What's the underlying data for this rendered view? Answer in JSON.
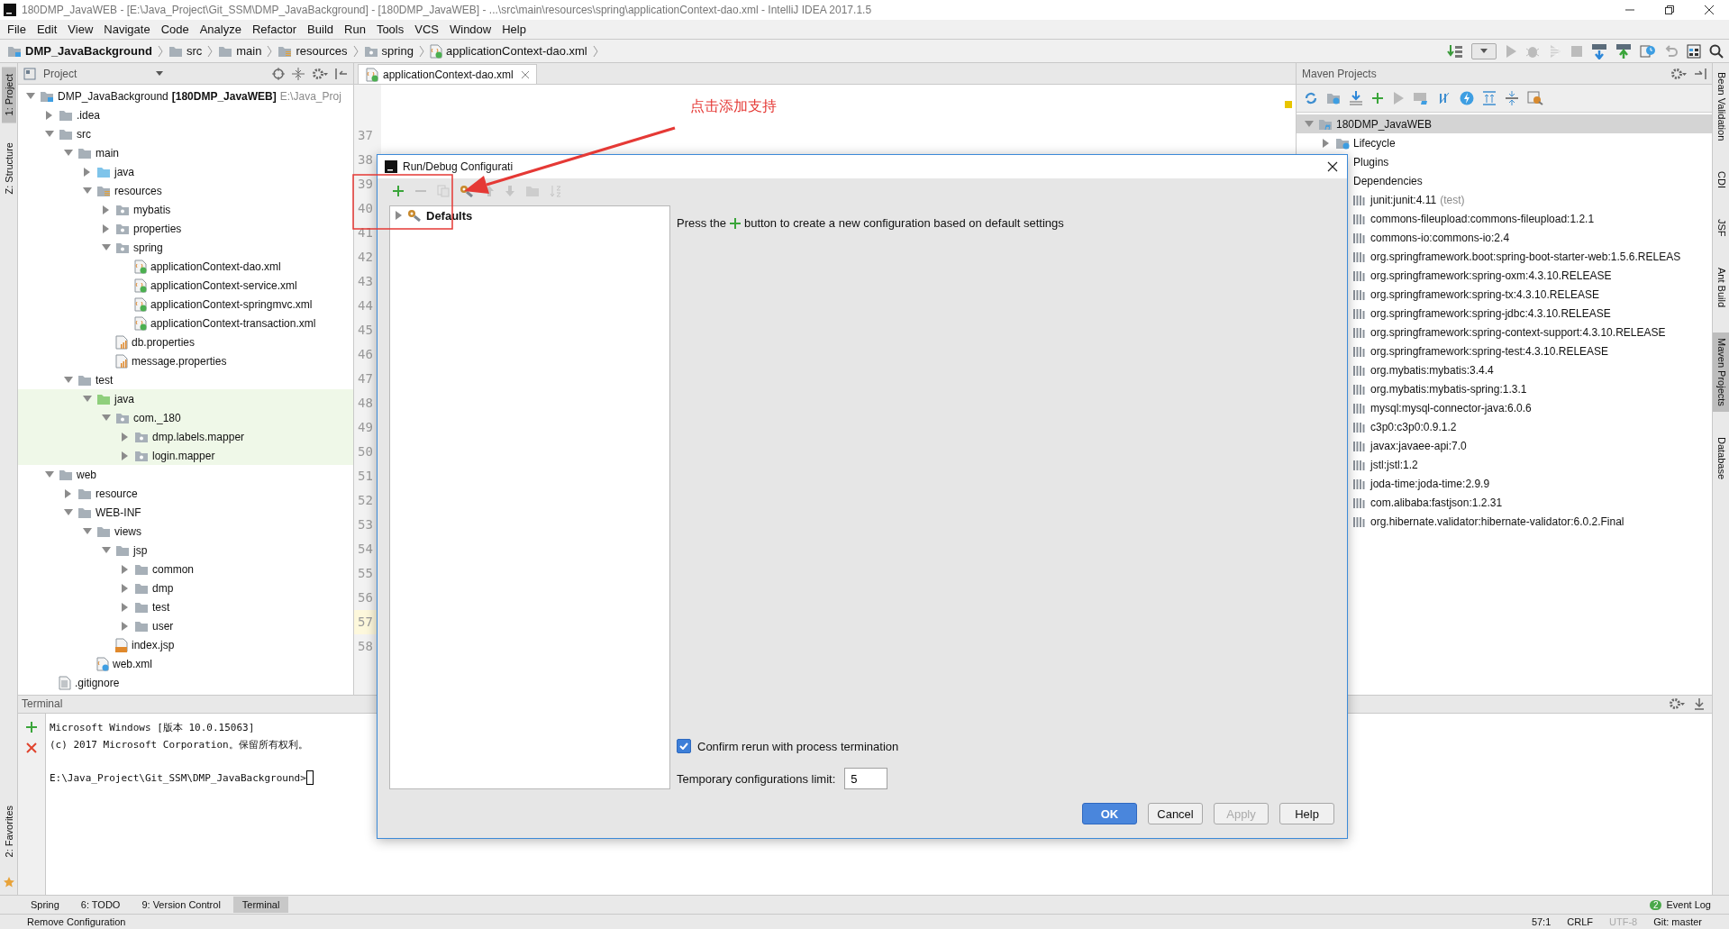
{
  "window": {
    "title": "180DMP_JavaWEB - [E:\\Java_Project\\Git_SSM\\DMP_JavaBackground] - [180DMP_JavaWEB] - ...\\src\\main\\resources\\spring\\applicationContext-dao.xml - IntelliJ IDEA 2017.1.5"
  },
  "menu": [
    "File",
    "Edit",
    "View",
    "Navigate",
    "Code",
    "Analyze",
    "Refactor",
    "Build",
    "Run",
    "Tools",
    "VCS",
    "Window",
    "Help"
  ],
  "breadcrumbs": [
    {
      "label": "DMP_JavaBackground",
      "kind": "module"
    },
    {
      "label": "src",
      "kind": "folder"
    },
    {
      "label": "main",
      "kind": "folder"
    },
    {
      "label": "resources",
      "kind": "resources"
    },
    {
      "label": "spring",
      "kind": "package"
    },
    {
      "label": "applicationContext-dao.xml",
      "kind": "spring-xml"
    }
  ],
  "left_strip": [
    {
      "label": "1: Project",
      "selected": true
    },
    {
      "label": "Z: Structure",
      "selected": false
    }
  ],
  "left_strip_bottom": [
    {
      "label": "2: Favorites",
      "selected": false
    }
  ],
  "project_panel": {
    "title": "Project",
    "tree": [
      {
        "label": "DMP_JavaBackground",
        "module": "[180DMP_JavaWEB]",
        "path": "E:\\Java_Proj",
        "kind": "module",
        "expanded": true,
        "children": [
          {
            "label": ".idea",
            "kind": "folder",
            "expanded": false
          },
          {
            "label": "src",
            "kind": "folder",
            "expanded": true,
            "children": [
              {
                "label": "main",
                "kind": "folder",
                "expanded": true,
                "children": [
                  {
                    "label": "java",
                    "kind": "source",
                    "expanded": false
                  },
                  {
                    "label": "resources",
                    "kind": "resources",
                    "expanded": true,
                    "children": [
                      {
                        "label": "mybatis",
                        "kind": "package",
                        "expanded": false
                      },
                      {
                        "label": "properties",
                        "kind": "package",
                        "expanded": false
                      },
                      {
                        "label": "spring",
                        "kind": "package",
                        "expanded": true,
                        "children": [
                          {
                            "label": "applicationContext-dao.xml",
                            "kind": "spring-xml"
                          },
                          {
                            "label": "applicationContext-service.xml",
                            "kind": "spring-xml"
                          },
                          {
                            "label": "applicationContext-springmvc.xml",
                            "kind": "spring-xml"
                          },
                          {
                            "label": "applicationContext-transaction.xml",
                            "kind": "spring-xml"
                          }
                        ]
                      },
                      {
                        "label": "db.properties",
                        "kind": "properties"
                      },
                      {
                        "label": "message.properties",
                        "kind": "properties"
                      }
                    ]
                  }
                ]
              },
              {
                "label": "test",
                "kind": "folder",
                "expanded": true,
                "children": [
                  {
                    "label": "java",
                    "kind": "test-source",
                    "expanded": true,
                    "children": [
                      {
                        "label": "com._180",
                        "kind": "package",
                        "expanded": true,
                        "children": [
                          {
                            "label": "dmp.labels.mapper",
                            "kind": "package",
                            "expanded": false
                          },
                          {
                            "label": "login.mapper",
                            "kind": "package",
                            "expanded": false
                          }
                        ]
                      }
                    ]
                  }
                ]
              }
            ]
          },
          {
            "label": "web",
            "kind": "folder",
            "expanded": true,
            "children": [
              {
                "label": "resource",
                "kind": "folder",
                "expanded": false
              },
              {
                "label": "WEB-INF",
                "kind": "folder",
                "expanded": true,
                "children": [
                  {
                    "label": "views",
                    "kind": "folder",
                    "expanded": true,
                    "children": [
                      {
                        "label": "jsp",
                        "kind": "folder",
                        "expanded": true,
                        "children": [
                          {
                            "label": "common",
                            "kind": "folder",
                            "expanded": false
                          },
                          {
                            "label": "dmp",
                            "kind": "folder",
                            "expanded": false
                          },
                          {
                            "label": "test",
                            "kind": "folder",
                            "expanded": false
                          },
                          {
                            "label": "user",
                            "kind": "folder",
                            "expanded": false
                          }
                        ]
                      },
                      {
                        "label": "index.jsp",
                        "kind": "jsp"
                      }
                    ]
                  },
                  {
                    "label": "web.xml",
                    "kind": "webxml"
                  }
                ]
              }
            ]
          },
          {
            "label": ".gitignore",
            "kind": "file"
          }
        ]
      }
    ]
  },
  "editor": {
    "tab": "applicationContext-dao.xml",
    "line_numbers": [
      {
        "n": "37",
        "current": false
      },
      {
        "n": "38",
        "current": false
      },
      {
        "n": "39",
        "current": false
      },
      {
        "n": "40",
        "current": false
      },
      {
        "n": "41",
        "current": false
      },
      {
        "n": "42",
        "current": false
      },
      {
        "n": "43",
        "current": false
      },
      {
        "n": "44",
        "current": false
      },
      {
        "n": "45",
        "current": false
      },
      {
        "n": "46",
        "current": false
      },
      {
        "n": "47",
        "current": false
      },
      {
        "n": "48",
        "current": false
      },
      {
        "n": "49",
        "current": false
      },
      {
        "n": "50",
        "current": false
      },
      {
        "n": "51",
        "current": false
      },
      {
        "n": "52",
        "current": false
      },
      {
        "n": "53",
        "current": false
      },
      {
        "n": "54",
        "current": false
      },
      {
        "n": "55",
        "current": false
      },
      {
        "n": "56",
        "current": false
      },
      {
        "n": "57",
        "current": true
      },
      {
        "n": "58",
        "current": false
      }
    ]
  },
  "maven": {
    "title": "Maven Projects",
    "tree": [
      {
        "label": "180DMP_JavaWEB",
        "kind": "maven-module",
        "expanded": true,
        "selected": true,
        "children": [
          {
            "label": "Lifecycle",
            "kind": "lifecycle",
            "expanded": false,
            "selected": false
          },
          {
            "label": "Plugins",
            "kind": "group",
            "selected": false
          },
          {
            "label": "Dependencies",
            "kind": "group",
            "selected": false,
            "children": [
              {
                "label": "junit:junit:4.11",
                "scope": "(test)",
                "kind": "dependency",
                "selected": false
              },
              {
                "label": "commons-fileupload:commons-fileupload:1.2.1",
                "kind": "dependency",
                "selected": false
              },
              {
                "label": "commons-io:commons-io:2.4",
                "kind": "dependency",
                "selected": false
              },
              {
                "label": "org.springframework.boot:spring-boot-starter-web:1.5.6.RELEAS",
                "kind": "dependency",
                "selected": false
              },
              {
                "label": "org.springframework:spring-oxm:4.3.10.RELEASE",
                "kind": "dependency",
                "selected": false
              },
              {
                "label": "org.springframework:spring-tx:4.3.10.RELEASE",
                "kind": "dependency",
                "selected": false
              },
              {
                "label": "org.springframework:spring-jdbc:4.3.10.RELEASE",
                "kind": "dependency",
                "selected": false
              },
              {
                "label": "org.springframework:spring-context-support:4.3.10.RELEASE",
                "kind": "dependency",
                "selected": false
              },
              {
                "label": "org.springframework:spring-test:4.3.10.RELEASE",
                "kind": "dependency",
                "selected": false
              },
              {
                "label": "org.mybatis:mybatis:3.4.4",
                "kind": "dependency",
                "selected": false
              },
              {
                "label": "org.mybatis:mybatis-spring:1.3.1",
                "kind": "dependency",
                "selected": false
              },
              {
                "label": "mysql:mysql-connector-java:6.0.6",
                "kind": "dependency",
                "selected": false
              },
              {
                "label": "c3p0:c3p0:0.9.1.2",
                "kind": "dependency",
                "selected": false
              },
              {
                "label": "javax:javaee-api:7.0",
                "kind": "dependency",
                "selected": false
              },
              {
                "label": "jstl:jstl:1.2",
                "kind": "dependency",
                "selected": false
              },
              {
                "label": "joda-time:joda-time:2.9.9",
                "kind": "dependency",
                "selected": false
              },
              {
                "label": "com.alibaba:fastjson:1.2.31",
                "kind": "dependency",
                "selected": false
              },
              {
                "label": "org.hibernate.validator:hibernate-validator:6.0.2.Final",
                "kind": "dependency",
                "selected": false
              }
            ]
          }
        ]
      }
    ]
  },
  "right_strip": [
    {
      "label": "Bean Validation",
      "selected": false
    },
    {
      "label": "CDI",
      "selected": false
    },
    {
      "label": "JSF",
      "selected": false
    },
    {
      "label": "Ant Build",
      "selected": false
    },
    {
      "label": "Maven Projects",
      "selected": true
    },
    {
      "label": "Database",
      "selected": false
    }
  ],
  "terminal": {
    "title": "Terminal",
    "lines": [
      "Microsoft Windows [版本 10.0.15063]",
      "(c) 2017 Microsoft Corporation。保留所有权利。"
    ],
    "prompt": "E:\\Java_Project\\Git_SSM\\DMP_JavaBackground>"
  },
  "tool_tabs": [
    {
      "label": "Spring",
      "selected": false
    },
    {
      "label": "6: TODO",
      "selected": false
    },
    {
      "label": "9: Version Control",
      "selected": false
    },
    {
      "label": "Terminal",
      "selected": true
    }
  ],
  "event_log": {
    "label": "Event Log",
    "count": "2"
  },
  "status_bar": {
    "message": "Remove Configuration",
    "items": [
      {
        "label": "57:1",
        "disabled": false
      },
      {
        "label": "CRLF",
        "disabled": false
      },
      {
        "label": "UTF-8",
        "disabled": true
      },
      {
        "label": "Git: master",
        "disabled": false
      }
    ]
  },
  "dialog": {
    "title": "Run/Debug Configurati",
    "toolbar": [
      {
        "kind": "add",
        "disabled": false
      },
      {
        "kind": "remove",
        "disabled": true
      },
      {
        "kind": "copy",
        "disabled": true
      },
      {
        "kind": "defaults",
        "disabled": false
      },
      {
        "kind": "up",
        "disabled": true
      },
      {
        "kind": "down",
        "disabled": true
      },
      {
        "kind": "folder",
        "disabled": true
      },
      {
        "kind": "sort",
        "disabled": true
      }
    ],
    "tree": [
      {
        "label": "Defaults",
        "expanded": false
      }
    ],
    "hint_before": "Press the",
    "hint_after": "button to create a new configuration based on default settings",
    "confirm_rerun": {
      "label": "Confirm rerun with process termination",
      "checked": true
    },
    "temp_limit": {
      "label": "Temporary configurations limit:",
      "value": "5"
    },
    "buttons": [
      {
        "label": "OK",
        "kind": "primary",
        "disabled": false
      },
      {
        "label": "Cancel",
        "kind": "normal",
        "disabled": false
      },
      {
        "label": "Apply",
        "kind": "normal",
        "disabled": true
      },
      {
        "label": "Help",
        "kind": "normal",
        "disabled": false
      }
    ]
  },
  "annotation": {
    "text": "点击添加支持"
  }
}
